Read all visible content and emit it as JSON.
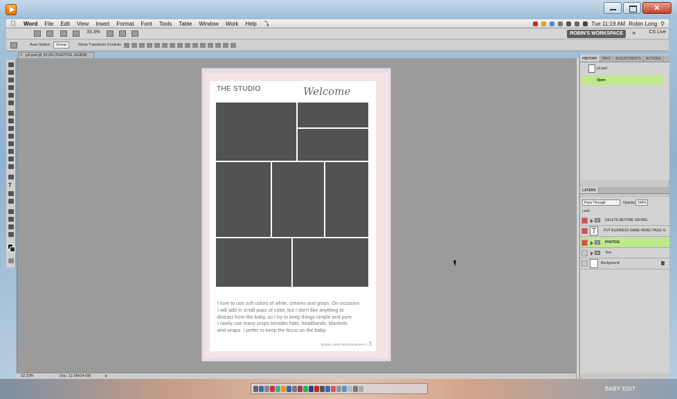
{
  "menubar": {
    "apple": "",
    "app_name": "Word",
    "items": [
      "File",
      "Edit",
      "View",
      "Insert",
      "Format",
      "Font",
      "Tools",
      "Table",
      "Window",
      "Work",
      "Help"
    ],
    "clock": "Tue 11:19 AM",
    "user": "Robin Long"
  },
  "appbar": {
    "zoom": "33.3%",
    "workspace": "ROBIN'S WORKSPACE",
    "more": "»",
    "cslive": "CS Live"
  },
  "options": {
    "auto_select_label": "Auto-Select:",
    "auto_select_value": "Group",
    "transform_label": "Show Transform Controls"
  },
  "document": {
    "tab_title": "p3.psd @ 33.3% (PHOTOS, RGB/8)",
    "status_zoom": "33.33%",
    "status_doc": "Doc: 12.0M/24.6M"
  },
  "page": {
    "title": "THE STUDIO",
    "welcome": "Welcome",
    "body": "I love to use soft colors of white, creams and grays.  On occasion\nI will add in small pops of color, but I don't like anything to\ndistract from the baby, so I try to keep things simple and pure.\nI rarely use many props besides hats, headbands, blankets\nand wraps.  I prefer to keep the focus on the baby.",
    "footer": "ROBIN LONG PHOTOGRAPHY |",
    "page_number": "3"
  },
  "history_panel": {
    "tabs": [
      "HISTORY",
      "INFO",
      "ADJUSTMENTS",
      "ACTIONS"
    ],
    "snapshot": "p3.psd",
    "state": "Open"
  },
  "layers_panel": {
    "tab": "LAYERS",
    "blend_mode": "Pass Through",
    "opacity_label": "Opacity:",
    "opacity": "100%",
    "lock_label": "Lock:",
    "layers": [
      {
        "name": "DELETE BEFORE SAVING",
        "visible_red": true
      },
      {
        "name": "PUT BUSINESS NAME HERE! PAGE N...",
        "visible_red": true
      },
      {
        "name": "PHOTOS",
        "selected": true
      },
      {
        "name": "Text"
      },
      {
        "name": "Background",
        "locked": true
      }
    ]
  },
  "desktop": {
    "caption": "BABY EDIT"
  },
  "colors": {
    "selection_green": "#bfe98d",
    "photo_gray": "#525252",
    "visibility_red": "#e04a4a"
  }
}
